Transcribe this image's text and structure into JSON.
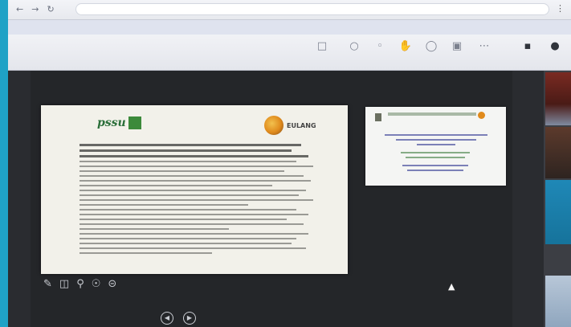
{
  "browser": {
    "url": "",
    "nav_icons": [
      "back-icon",
      "forward-icon",
      "reload-icon"
    ],
    "menu_icon": "more-icon"
  },
  "notice": {
    "text": ""
  },
  "toolbar": {
    "app_name": "",
    "tools": [
      {
        "name": "presentation",
        "label": ""
      },
      {
        "name": "chat",
        "label": ""
      },
      {
        "name": "camera",
        "label": ""
      },
      {
        "name": "hand",
        "label": ""
      },
      {
        "name": "share",
        "label": ""
      },
      {
        "name": "record",
        "label": ""
      },
      {
        "name": "more",
        "label": ""
      },
      {
        "name": "video",
        "label": ""
      },
      {
        "name": "leave",
        "label": ""
      }
    ]
  },
  "main_slide": {
    "logo_left": "pssu",
    "logo_right": "EULANG"
  },
  "side_slide": {
    "logo_right": ""
  },
  "side_caption": "",
  "pager": {
    "label": ""
  },
  "slide_tools": [
    "pen-icon",
    "layout-icon",
    "search-icon",
    "pointer-icon",
    "minus-icon"
  ],
  "colors": {
    "frame": "#1fa2c6",
    "stage": "#242629",
    "toolbar": "#eceef2"
  }
}
